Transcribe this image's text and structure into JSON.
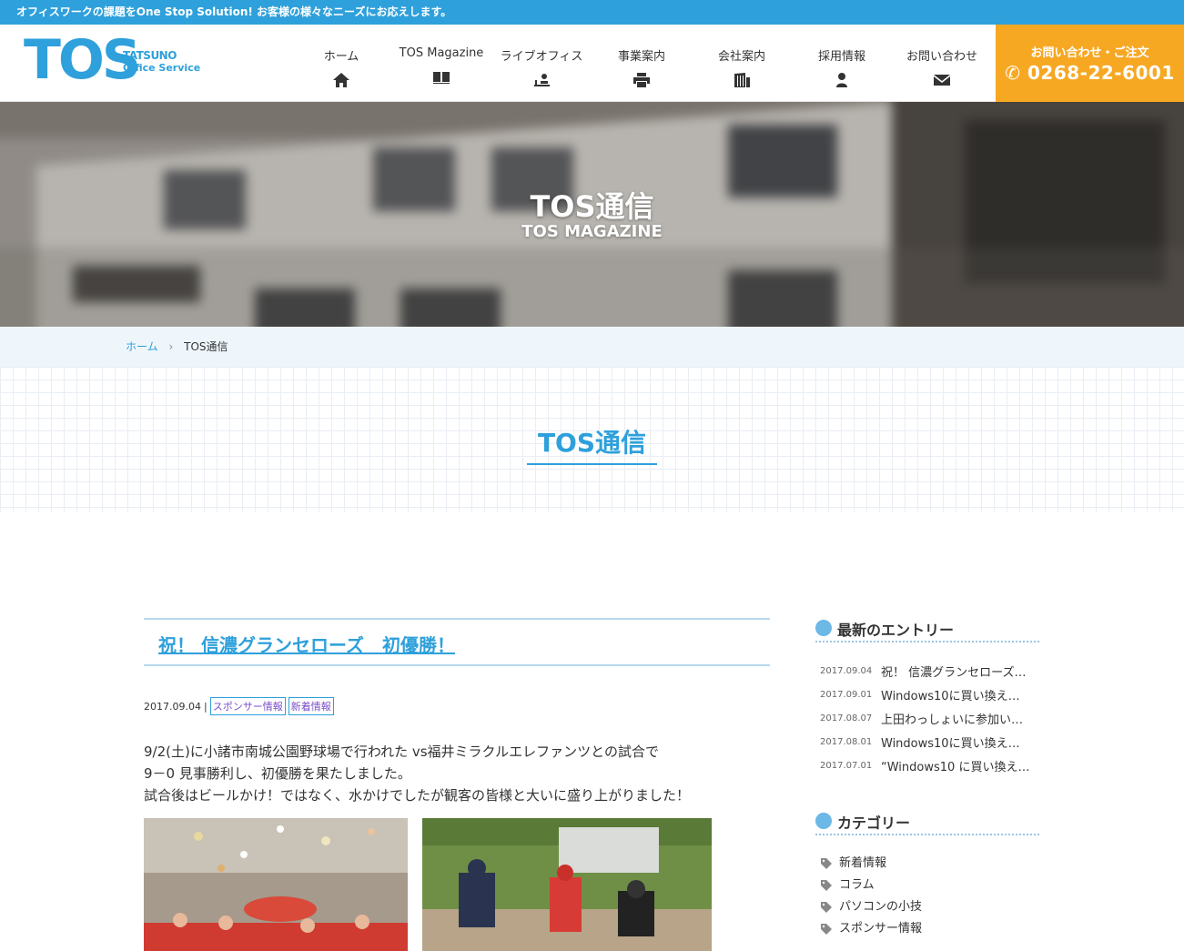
{
  "topbar": {
    "text": "オフィスワークの課題をOne Stop Solution! お客様の様々なニーズにお応えします。"
  },
  "logo": {
    "main": "TOS",
    "line1": "TATSUNO",
    "line2": "Office Service"
  },
  "nav": {
    "items": [
      {
        "label": "ホーム",
        "icon": "home-icon"
      },
      {
        "label": "TOS Magazine",
        "icon": "book-icon"
      },
      {
        "label": "ライブオフィス",
        "icon": "desk-icon"
      },
      {
        "label": "事業案内",
        "icon": "printer-icon"
      },
      {
        "label": "会社案内",
        "icon": "building-icon"
      },
      {
        "label": "採用情報",
        "icon": "person-icon"
      },
      {
        "label": "お問い合わせ",
        "icon": "mail-icon"
      }
    ]
  },
  "contact": {
    "title": "お問い合わせ・ご注文",
    "phone": "0268-22-6001"
  },
  "hero": {
    "title": "TOS通信",
    "subtitle": "TOS MAGAZINE"
  },
  "breadcrumb": {
    "home": "ホーム",
    "separator": "›",
    "current": "TOS通信"
  },
  "page_title": "TOS通信",
  "article": {
    "title": "祝！ 信濃グランセローズ　初優勝！",
    "date": "2017.09.04",
    "separator": "|",
    "tags": [
      "スポンサー情報",
      "新着情報"
    ],
    "body": [
      "9/2(土)に小諸市南城公園野球場で行われた vs福井ミラクルエレファンツとの試合で",
      "9－0 見事勝利し、初優勝を果たしました。",
      "試合後はビールかけ！ではなく、水かけでしたが観客の皆様と大いに盛り上がりました！"
    ]
  },
  "sidebar": {
    "latest_heading": "最新のエントリー",
    "entries": [
      {
        "date": "2017.09.04",
        "title": "祝！ 信濃グランセローズ…"
      },
      {
        "date": "2017.09.01",
        "title": "Windows10に買い換え…"
      },
      {
        "date": "2017.08.07",
        "title": "上田わっしょいに参加い…"
      },
      {
        "date": "2017.08.01",
        "title": "Windows10に買い換え…"
      },
      {
        "date": "2017.07.01",
        "title": "“Windows10 に買い換え…"
      }
    ],
    "category_heading": "カテゴリー",
    "categories": [
      "新着情報",
      "コラム",
      "パソコンの小技",
      "スポンサー情報"
    ]
  },
  "colors": {
    "accent": "#2ea0db",
    "contact": "#f7a823",
    "breadcrumb_bg": "#eef6fc"
  }
}
